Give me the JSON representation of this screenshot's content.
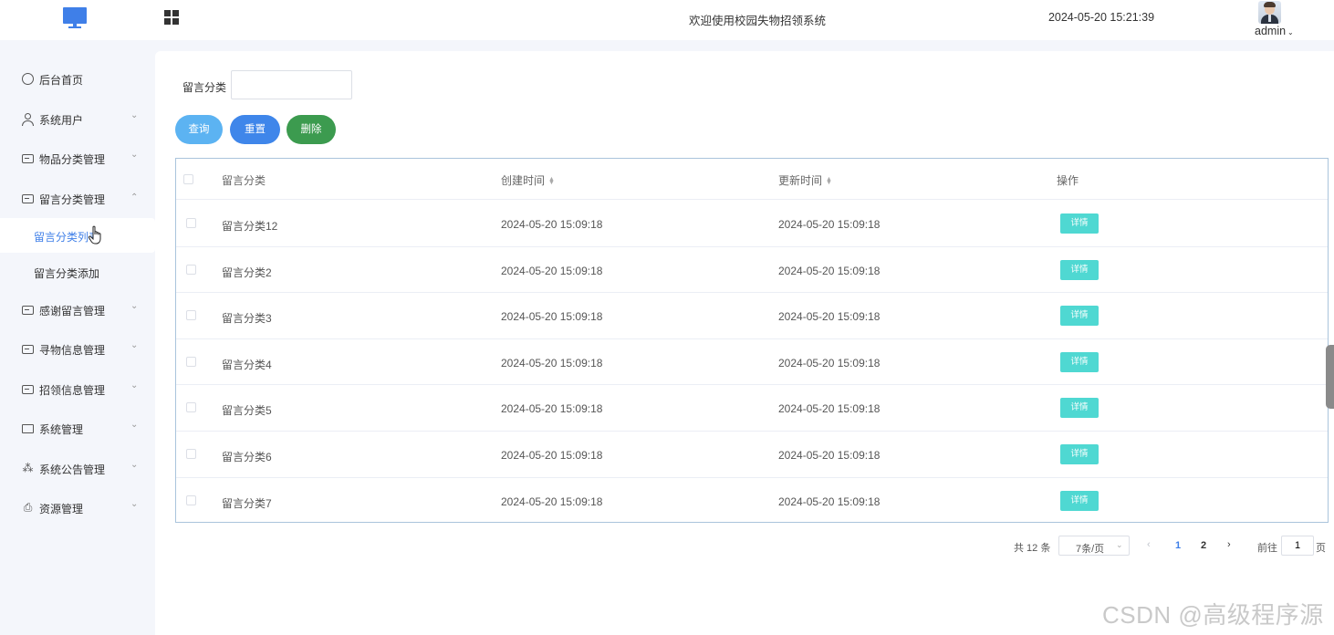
{
  "header": {
    "system_title": "欢迎使用校园失物招领系统",
    "datetime": "2024-05-20 15:21:39",
    "user_name": "admin",
    "logo_icon": "monitor-icon",
    "menu_toggle_icon": "grid-icon"
  },
  "sidebar": {
    "items": [
      {
        "label": "后台首页",
        "icon": "clock-icon"
      },
      {
        "label": "系统用户",
        "icon": "user-icon"
      },
      {
        "label": "物品分类管理",
        "icon": "card-icon"
      },
      {
        "label": "留言分类管理",
        "icon": "card-icon",
        "expanded": true
      },
      {
        "label": "感谢留言管理",
        "icon": "card-icon"
      },
      {
        "label": "寻物信息管理",
        "icon": "card-icon"
      },
      {
        "label": "招领信息管理",
        "icon": "card-icon"
      },
      {
        "label": "系统管理",
        "icon": "folder-icon"
      },
      {
        "label": "系统公告管理",
        "icon": "loading-icon"
      },
      {
        "label": "资源管理",
        "icon": "printer-icon"
      }
    ],
    "sub_items": [
      {
        "label": "留言分类列表",
        "active": true
      },
      {
        "label": "留言分类添加",
        "active": false
      }
    ]
  },
  "search": {
    "label": "留言分类",
    "value": "",
    "placeholder": ""
  },
  "buttons": {
    "query": "查询",
    "reset": "重置",
    "delete": "删除"
  },
  "table": {
    "columns": [
      "留言分类",
      "创建时间",
      "更新时间",
      "操作"
    ],
    "rows": [
      {
        "category": "留言分类12",
        "created": "2024-05-20 15:09:18",
        "updated": "2024-05-20 15:09:18",
        "action": "详情"
      },
      {
        "category": "留言分类2",
        "created": "2024-05-20 15:09:18",
        "updated": "2024-05-20 15:09:18",
        "action": "详情"
      },
      {
        "category": "留言分类3",
        "created": "2024-05-20 15:09:18",
        "updated": "2024-05-20 15:09:18",
        "action": "详情"
      },
      {
        "category": "留言分类4",
        "created": "2024-05-20 15:09:18",
        "updated": "2024-05-20 15:09:18",
        "action": "详情"
      },
      {
        "category": "留言分类5",
        "created": "2024-05-20 15:09:18",
        "updated": "2024-05-20 15:09:18",
        "action": "详情"
      },
      {
        "category": "留言分类6",
        "created": "2024-05-20 15:09:18",
        "updated": "2024-05-20 15:09:18",
        "action": "详情"
      },
      {
        "category": "留言分类7",
        "created": "2024-05-20 15:09:18",
        "updated": "2024-05-20 15:09:18",
        "action": "详情"
      }
    ]
  },
  "pagination": {
    "total": "共 12 条",
    "page_size": "7条/页",
    "pages": [
      "1",
      "2"
    ],
    "current_page": "1",
    "goto_label": "前往",
    "goto_value": "1",
    "page_suffix": "页"
  },
  "watermark": "CSDN @高级程序源",
  "colors": {
    "accent": "#3f7fe8",
    "query_button": "#5cb3f2",
    "reset_button": "#3f86ea",
    "delete_button": "#3c9b4f",
    "detail_button": "#4fd8d2"
  }
}
